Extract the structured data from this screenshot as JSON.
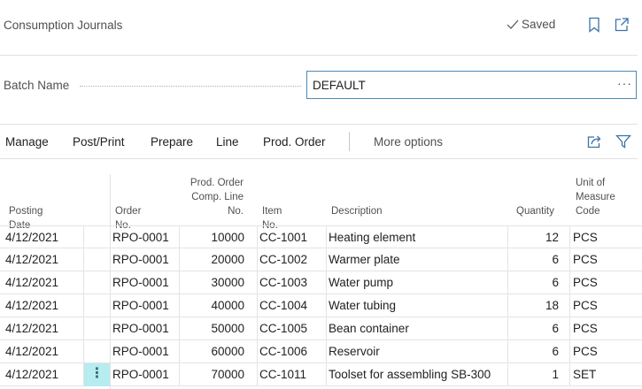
{
  "header": {
    "title": "Consumption Journals",
    "saved_label": "Saved",
    "icons": [
      "checkmark-icon",
      "bookmark-icon",
      "popout-icon"
    ]
  },
  "batch": {
    "label": "Batch Name",
    "value": "DEFAULT",
    "more_label": "···"
  },
  "actions": {
    "items": [
      "Manage",
      "Post/Print",
      "Prepare",
      "Line",
      "Prod. Order"
    ],
    "more_options": "More options",
    "icons": [
      "share-icon",
      "filter-icon"
    ]
  },
  "table": {
    "headers": {
      "posting_date": "Posting Date",
      "order_no": "Order No.",
      "comp_line_1": "Prod. Order",
      "comp_line_2": "Comp. Line",
      "comp_line_3": "No.",
      "item_no": "Item No.",
      "description": "Description",
      "quantity": "Quantity",
      "uom_1": "Unit of",
      "uom_2": "Measure",
      "uom_3": "Code"
    },
    "rows": [
      {
        "date": "4/12/2021",
        "order": "RPO-0001",
        "line": "10000",
        "item": "CC-1001",
        "desc": "Heating element",
        "qty": "12",
        "uom": "PCS"
      },
      {
        "date": "4/12/2021",
        "order": "RPO-0001",
        "line": "20000",
        "item": "CC-1002",
        "desc": "Warmer plate",
        "qty": "6",
        "uom": "PCS"
      },
      {
        "date": "4/12/2021",
        "order": "RPO-0001",
        "line": "30000",
        "item": "CC-1003",
        "desc": "Water pump",
        "qty": "6",
        "uom": "PCS"
      },
      {
        "date": "4/12/2021",
        "order": "RPO-0001",
        "line": "40000",
        "item": "CC-1004",
        "desc": "Water tubing",
        "qty": "18",
        "uom": "PCS"
      },
      {
        "date": "4/12/2021",
        "order": "RPO-0001",
        "line": "50000",
        "item": "CC-1005",
        "desc": "Bean container",
        "qty": "6",
        "uom": "PCS"
      },
      {
        "date": "4/12/2021",
        "order": "RPO-0001",
        "line": "60000",
        "item": "CC-1006",
        "desc": "Reservoir",
        "qty": "6",
        "uom": "PCS"
      },
      {
        "date": "4/12/2021",
        "order": "RPO-0001",
        "line": "70000",
        "item": "CC-1011",
        "desc": "Toolset for assembling SB-300",
        "qty": "1",
        "uom": "SET"
      }
    ],
    "row_menu_label": "⋮"
  },
  "colors": {
    "accent": "#4b8bb8",
    "selected_cell": "#b7ecf0",
    "separator": "#e1e1e1"
  }
}
